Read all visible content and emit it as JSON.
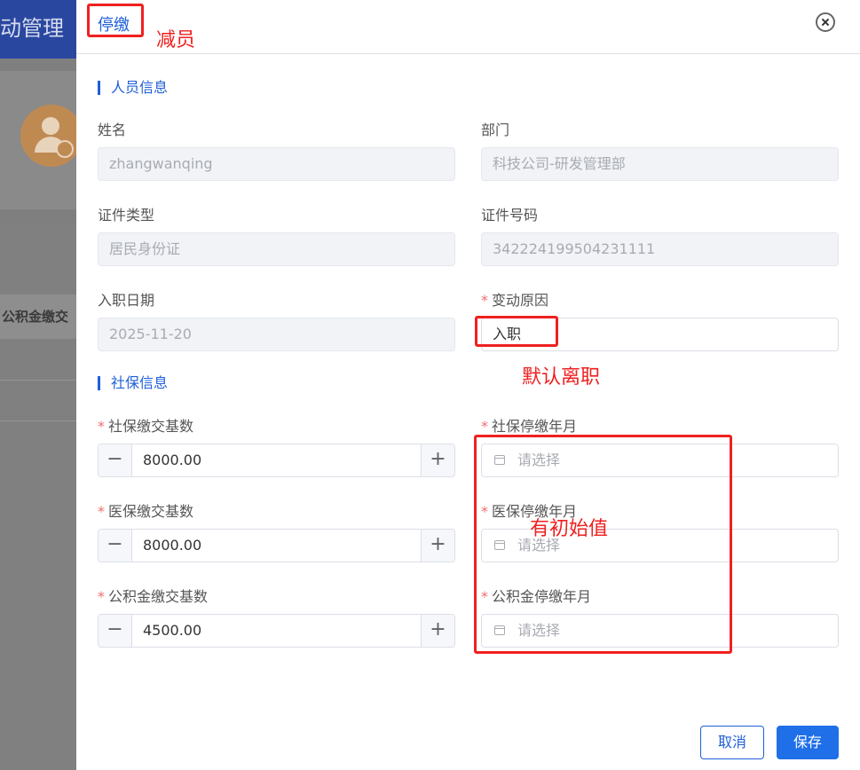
{
  "background": {
    "title": "动管理",
    "column_label": "公积金缴交"
  },
  "drawer": {
    "title": "停缴",
    "sections": {
      "person": "人员信息",
      "social": "社保信息"
    },
    "fields": {
      "name": {
        "label": "姓名",
        "value": "zhangwanqing"
      },
      "department": {
        "label": "部门",
        "value": "科技公司-研发管理部"
      },
      "id_type": {
        "label": "证件类型",
        "value": "居民身份证"
      },
      "id_number": {
        "label": "证件号码",
        "value": "342224199504231111"
      },
      "hire_date": {
        "label": "入职日期",
        "value": "2025-11-20"
      },
      "change_reason": {
        "label": "变动原因",
        "value": "入职"
      },
      "social_base": {
        "label": "社保缴交基数",
        "value": "8000.00"
      },
      "medical_base": {
        "label": "医保缴交基数",
        "value": "8000.00"
      },
      "fund_base": {
        "label": "公积金缴交基数",
        "value": "4500.00"
      },
      "social_stop": {
        "label": "社保停缴年月",
        "placeholder": "请选择"
      },
      "medical_stop": {
        "label": "医保停缴年月",
        "placeholder": "请选择"
      },
      "fund_stop": {
        "label": "公积金停缴年月",
        "placeholder": "请选择"
      }
    },
    "buttons": {
      "cancel": "取消",
      "save": "保存"
    }
  },
  "annotations": {
    "title_note": "减员",
    "reason_note": "默认离职",
    "date_note": "有初始值"
  },
  "colors": {
    "accent": "#1f5fd8",
    "required": "#f56c6c",
    "annotation": "#f02020"
  }
}
